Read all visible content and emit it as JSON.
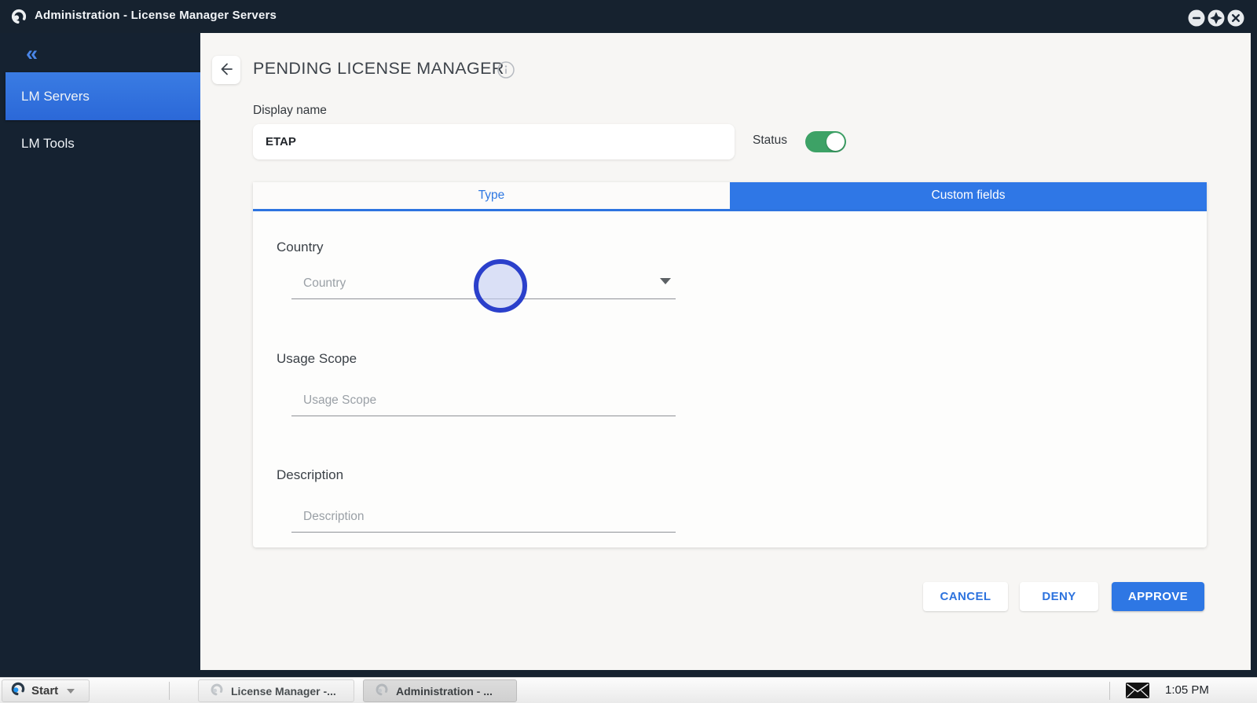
{
  "titlebar": {
    "title": "Administration - License Manager Servers"
  },
  "sidebar": {
    "collapse_icon": "«",
    "items": [
      {
        "label": "LM Servers",
        "selected": true
      },
      {
        "label": "LM Tools",
        "selected": false
      }
    ]
  },
  "header": {
    "title": "PENDING LICENSE MANAGER"
  },
  "form": {
    "display_name": {
      "label": "Display name",
      "value": "ETAP"
    },
    "status": {
      "label": "Status",
      "enabled": true
    },
    "tabs": [
      {
        "label": "Type",
        "active": false
      },
      {
        "label": "Custom fields",
        "active": true
      }
    ],
    "fields": [
      {
        "label": "Country",
        "placeholder": "Country",
        "type": "dropdown",
        "value": ""
      },
      {
        "label": "Usage Scope",
        "placeholder": "Usage Scope",
        "type": "text",
        "value": ""
      },
      {
        "label": "Description",
        "placeholder": "Description",
        "type": "text",
        "value": ""
      }
    ]
  },
  "actions": [
    {
      "label": "CANCEL",
      "primary": false
    },
    {
      "label": "DENY",
      "primary": false
    },
    {
      "label": "APPROVE",
      "primary": true
    }
  ],
  "taskbar": {
    "start_label": "Start",
    "apps": [
      {
        "label": "License Manager -...",
        "active": false
      },
      {
        "label": "Administration - ...",
        "active": true
      }
    ],
    "clock": "1:05 PM"
  },
  "colors": {
    "titlebar_bg": "#16222f",
    "sidebar_bg": "#152231",
    "sidebar_selected_blue": "#2d6fd9",
    "accent_blue": "#2f77e6",
    "tab_text_blue": "#2e78e2",
    "toggle_green": "#3da266",
    "content_bg": "#f7f6f4",
    "click_circle_border": "#2b40cb",
    "click_circle_fill": "#c5cef2"
  }
}
